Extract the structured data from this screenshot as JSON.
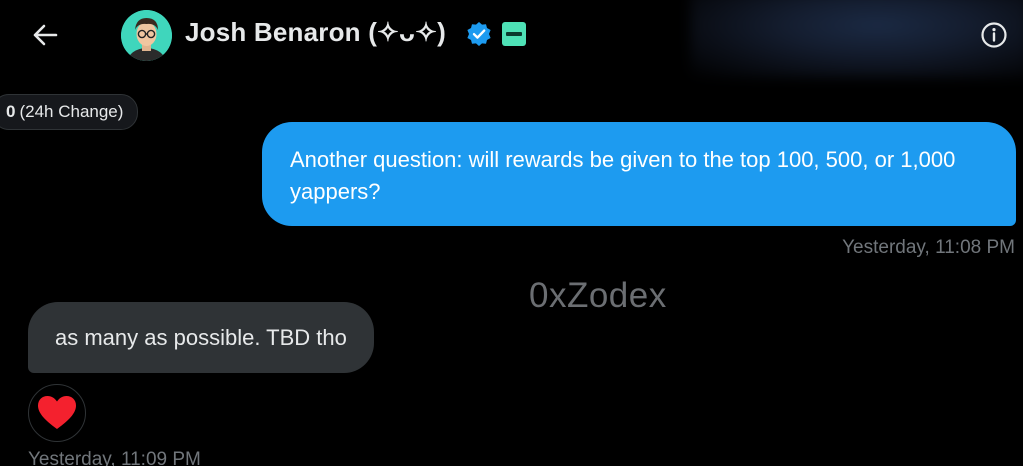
{
  "header": {
    "back_icon": "arrow-left-icon",
    "display_name": "Josh Benaron (✧ᴗ✧)",
    "verified_icon": "verified-badge-icon",
    "affiliate_badge_icon": "affiliate-badge-icon",
    "info_icon": "info-circle-icon"
  },
  "change_pill": {
    "value": "0",
    "label": "(24h Change)"
  },
  "messages": [
    {
      "direction": "sent",
      "text": "Another question: will rewards be given to the top 100, 500, or 1,000 yappers?",
      "timestamp": "Yesterday, 11:08 PM"
    },
    {
      "direction": "received",
      "text": "as many as possible. TBD tho",
      "reaction_icon": "heart-icon",
      "timestamp": "Yesterday, 11:09 PM"
    }
  ],
  "watermark": "0xZodex",
  "colors": {
    "sent_bubble": "#1d9bf0",
    "received_bubble": "#2f3336",
    "verified": "#1d9bf0",
    "heart": "#f4212e",
    "timestamp": "#71767b"
  }
}
